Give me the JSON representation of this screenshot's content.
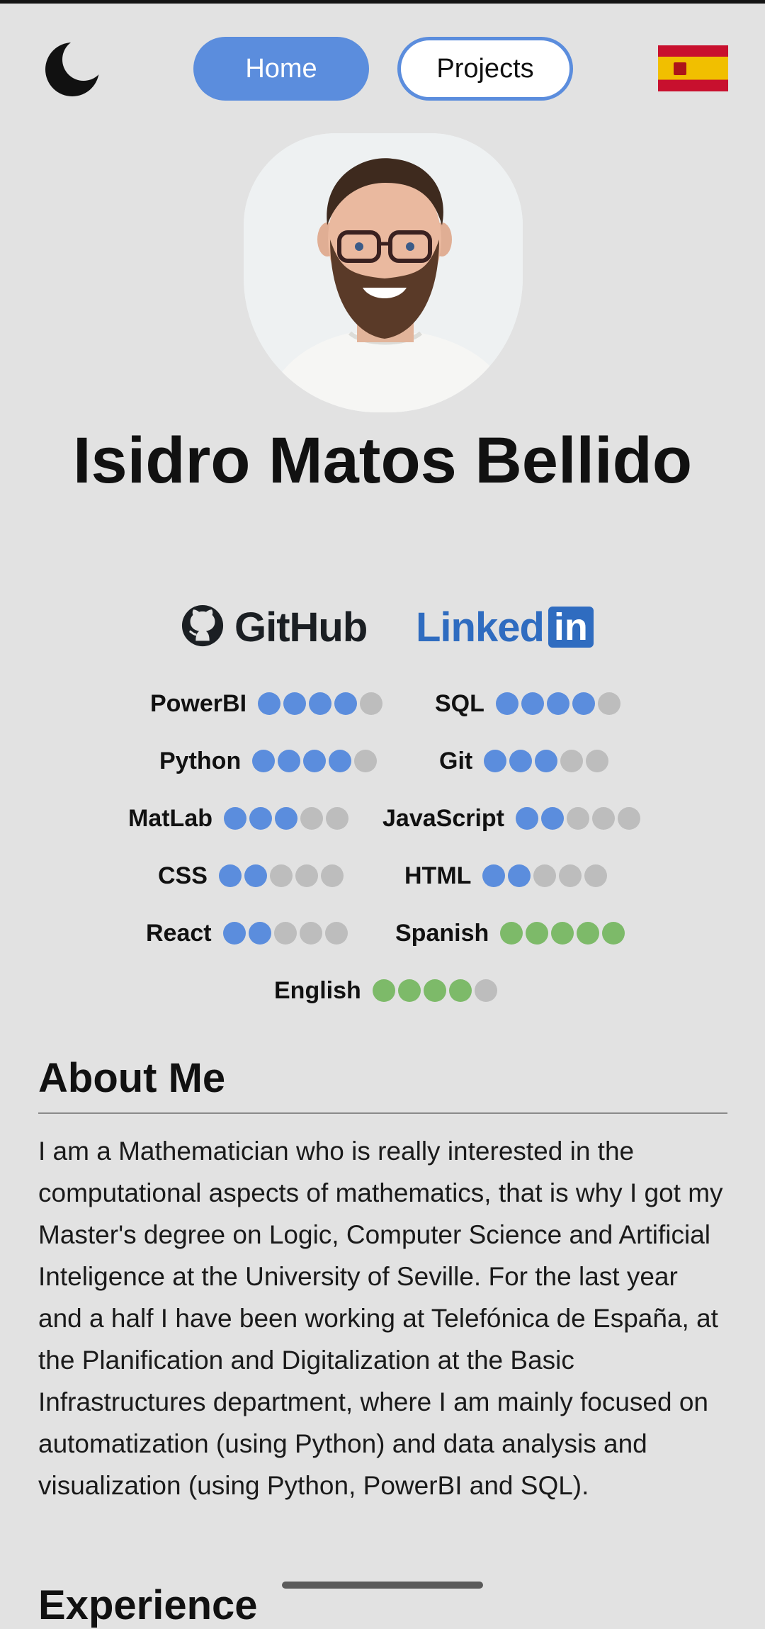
{
  "header": {
    "theme_icon": "moon-icon",
    "nav": [
      {
        "label": "Home"
      },
      {
        "label": "Projects"
      }
    ],
    "language_icon": "spain-flag-icon"
  },
  "profile": {
    "name": "Isidro Matos Bellido",
    "photo_icon": "profile-photo"
  },
  "social": {
    "github": "GitHub",
    "linkedin_text": "Linked",
    "linkedin_box": "in"
  },
  "colors": {
    "accent": "#5b8ddd",
    "language_dot": "#7dba69",
    "empty_dot": "#bdbdbd",
    "background": "#e2e2e2"
  },
  "skills": [
    {
      "name": "PowerBI",
      "level": 4,
      "max": 5,
      "kind": "tech"
    },
    {
      "name": "SQL",
      "level": 4,
      "max": 5,
      "kind": "tech"
    },
    {
      "name": "Python",
      "level": 4,
      "max": 5,
      "kind": "tech"
    },
    {
      "name": "Git",
      "level": 3,
      "max": 5,
      "kind": "tech"
    },
    {
      "name": "MatLab",
      "level": 3,
      "max": 5,
      "kind": "tech"
    },
    {
      "name": "JavaScript",
      "level": 2,
      "max": 5,
      "kind": "tech"
    },
    {
      "name": "CSS",
      "level": 2,
      "max": 5,
      "kind": "tech"
    },
    {
      "name": "HTML",
      "level": 2,
      "max": 5,
      "kind": "tech"
    },
    {
      "name": "React",
      "level": 2,
      "max": 5,
      "kind": "tech"
    },
    {
      "name": "Spanish",
      "level": 5,
      "max": 5,
      "kind": "language"
    },
    {
      "name": "English",
      "level": 4,
      "max": 5,
      "kind": "language"
    }
  ],
  "about": {
    "title": "About Me",
    "text": "I am a Mathematician who is really interested in the computational aspects of mathematics, that is why I got my Master's degree on Logic, Computer Science and Artificial Inteligence at the University of Seville. For the last year and a half I have been working at Telefónica de España, at the Planification and Digitalization at the Basic Infrastructures department, where I am mainly focused on automatization (using Python) and data analysis and visualization (using Python, PowerBI and SQL)."
  },
  "next_section": {
    "title": "Experience"
  }
}
